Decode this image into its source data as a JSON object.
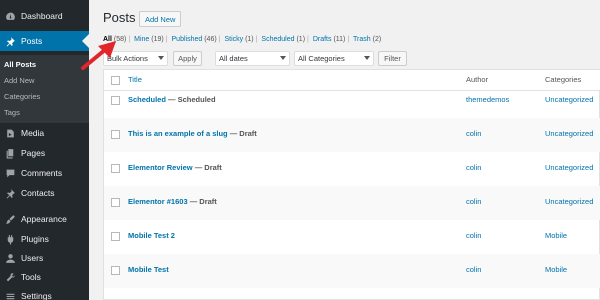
{
  "sidebar": {
    "items": [
      {
        "label": "Dashboard",
        "icon": "dashboard-icon"
      },
      {
        "label": "Posts",
        "icon": "pin-icon"
      },
      {
        "label": "Media",
        "icon": "media-icon"
      },
      {
        "label": "Pages",
        "icon": "pages-icon"
      },
      {
        "label": "Comments",
        "icon": "comments-icon"
      },
      {
        "label": "Contacts",
        "icon": "pin-icon"
      },
      {
        "label": "Appearance",
        "icon": "brush-icon"
      },
      {
        "label": "Plugins",
        "icon": "plugin-icon"
      },
      {
        "label": "Users",
        "icon": "users-icon"
      },
      {
        "label": "Tools",
        "icon": "wrench-icon"
      },
      {
        "label": "Settings",
        "icon": "settings-icon"
      }
    ],
    "submenu": [
      {
        "label": "All Posts"
      },
      {
        "label": "Add New"
      },
      {
        "label": "Categories"
      },
      {
        "label": "Tags"
      }
    ]
  },
  "header": {
    "title": "Posts",
    "add_new": "Add New"
  },
  "filters": {
    "views": [
      {
        "label": "All",
        "count": "(58)"
      },
      {
        "label": "Mine",
        "count": "(19)"
      },
      {
        "label": "Published",
        "count": "(46)"
      },
      {
        "label": "Sticky",
        "count": "(1)"
      },
      {
        "label": "Scheduled",
        "count": "(1)"
      },
      {
        "label": "Drafts",
        "count": "(11)"
      },
      {
        "label": "Trash",
        "count": "(2)"
      }
    ],
    "separator": "|",
    "bulk_actions": "Bulk Actions",
    "apply": "Apply",
    "dates": "All dates",
    "categories": "All Categories",
    "filter": "Filter"
  },
  "table": {
    "columns": {
      "title": "Title",
      "author": "Author",
      "categories": "Categories"
    },
    "rows": [
      {
        "title": "Scheduled",
        "state": "— Scheduled",
        "author": "themedemos",
        "category": "Uncategorized"
      },
      {
        "title": "This is an example of a slug",
        "state": "— Draft",
        "author": "colin",
        "category": "Uncategorized"
      },
      {
        "title": "Elementor Review",
        "state": "— Draft",
        "author": "colin",
        "category": "Uncategorized"
      },
      {
        "title": "Elementor #1603",
        "state": "— Draft",
        "author": "colin",
        "category": "Uncategorized"
      },
      {
        "title": "Mobile Test 2",
        "state": "",
        "author": "colin",
        "category": "Mobile"
      },
      {
        "title": "Mobile Test",
        "state": "",
        "author": "colin",
        "category": "Mobile"
      }
    ]
  },
  "colors": {
    "sidebar_bg": "#23282d",
    "accent": "#0073aa",
    "arrow": "#e0262b"
  }
}
